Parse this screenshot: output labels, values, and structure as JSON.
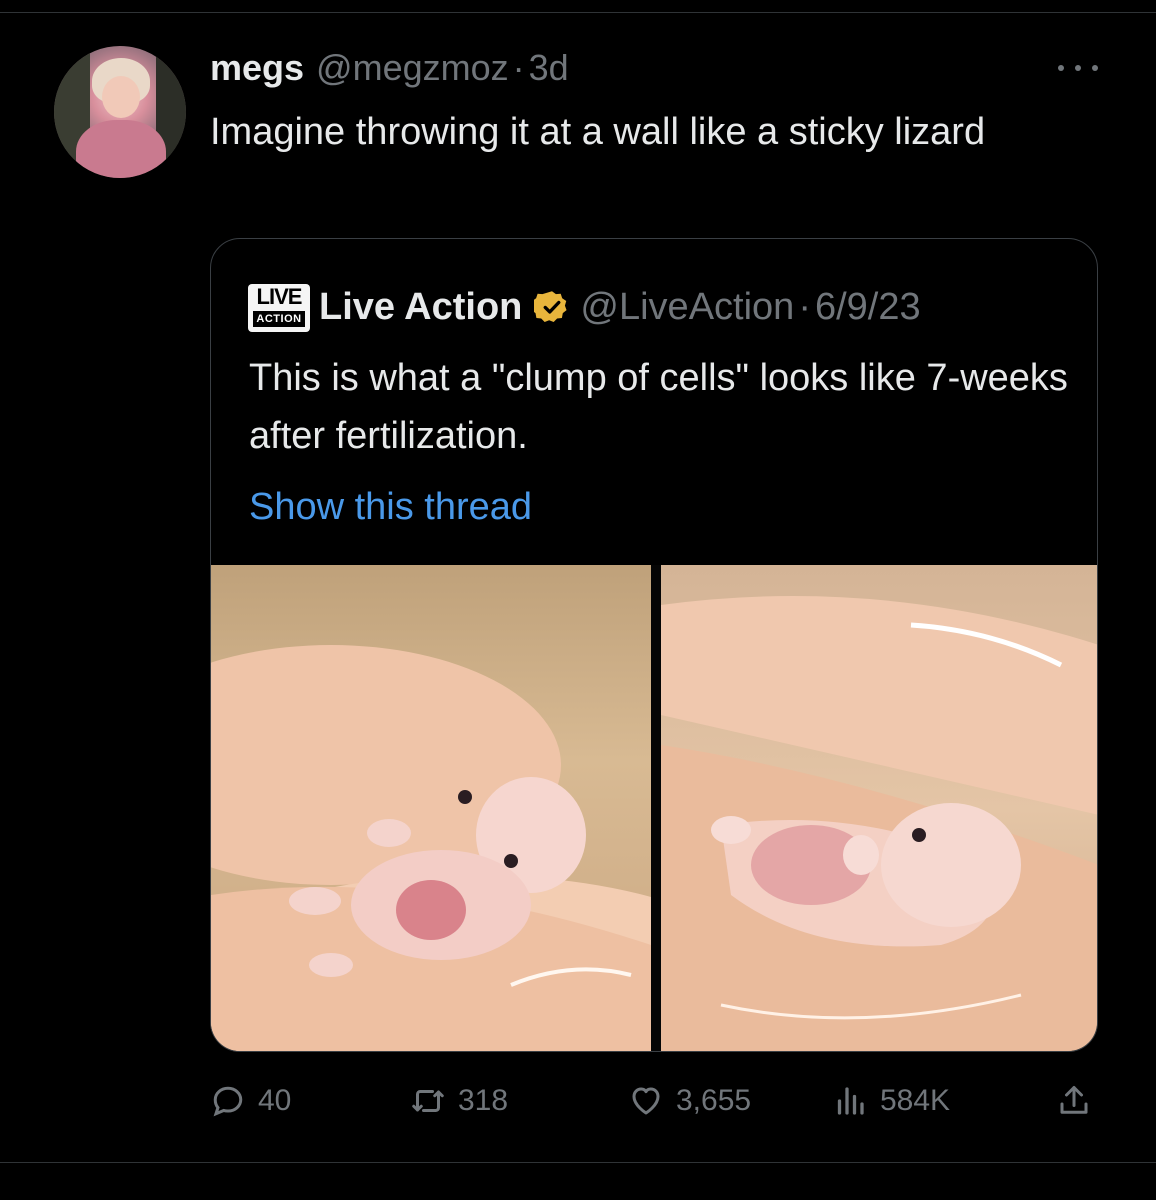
{
  "tweet": {
    "display_name": "megs",
    "handle": "@megzmoz",
    "separator": "·",
    "time": "3d",
    "text": "Imagine throwing it at a wall like a sticky lizard"
  },
  "quote": {
    "logo_line1": "LIVE",
    "logo_line2": "ACTION",
    "display_name": "Live Action",
    "handle": "@LiveAction",
    "separator": "·",
    "date": "6/9/23",
    "text": "This is what a \"clump of cells\" looks like 7-weeks after fertilization.",
    "show_thread": "Show this thread",
    "icons": {
      "verified": "verified-badge-icon"
    },
    "colors": {
      "verified_badge": "#e8b53c",
      "link": "#4a99e9"
    }
  },
  "actions": {
    "reply_count": "40",
    "retweet_count": "318",
    "like_count": "3,655",
    "view_count": "584K",
    "icons": [
      "reply-icon",
      "retweet-icon",
      "like-icon",
      "views-icon",
      "share-icon"
    ]
  },
  "colors": {
    "background": "#000000",
    "text": "#e7e9ea",
    "muted": "#71767b",
    "border": "#2f3336"
  }
}
